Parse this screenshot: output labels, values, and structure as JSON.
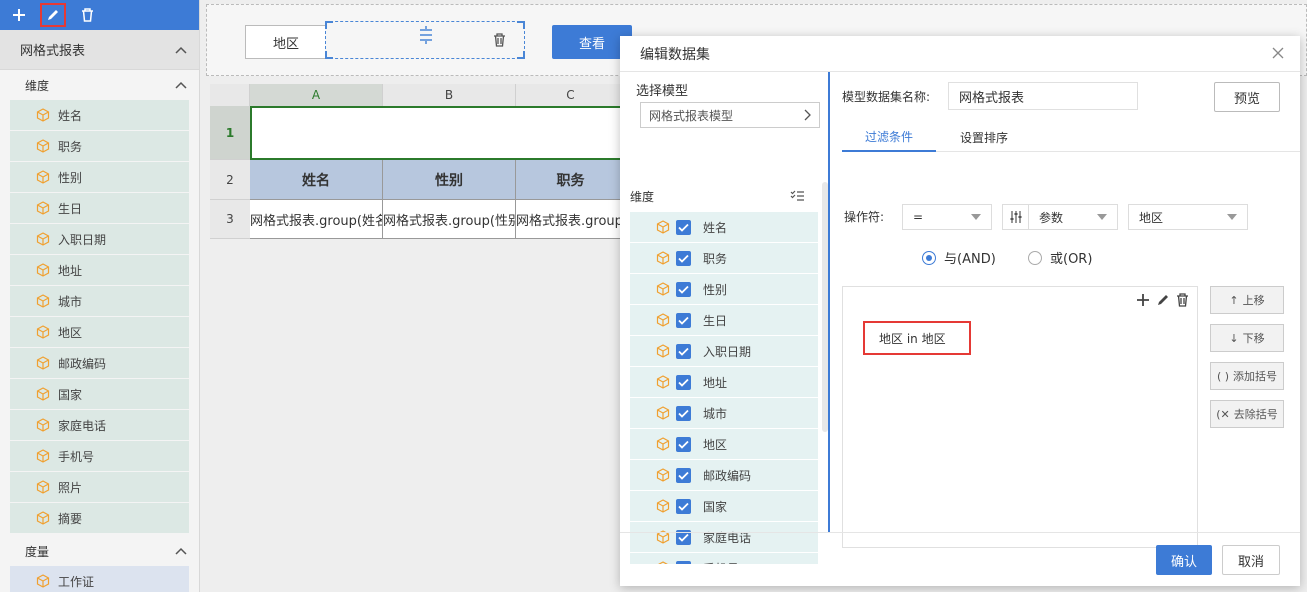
{
  "sidebar": {
    "section_title": "网格式报表",
    "dimension_title": "维度",
    "dimensions": [
      "姓名",
      "职务",
      "性别",
      "生日",
      "入职日期",
      "地址",
      "城市",
      "地区",
      "邮政编码",
      "国家",
      "家庭电话",
      "手机号",
      "照片",
      "摘要"
    ],
    "measure_title": "度量",
    "measures": [
      "工作证"
    ]
  },
  "param_panel": {
    "label": "地区",
    "view_button": "查看"
  },
  "grid": {
    "columns": [
      "A",
      "B",
      "C"
    ],
    "rows": [
      "1",
      "2",
      "3"
    ],
    "header_cells": [
      "姓名",
      "性别",
      "职务"
    ],
    "body_cells": [
      "网格式报表.group(姓名)",
      "网格式报表.group(性别)",
      "网格式报表.group(职务)"
    ]
  },
  "dialog": {
    "title": "编辑数据集",
    "select_model_label": "选择模型",
    "model_value": "网格式报表模型",
    "dimension_label": "维度",
    "dimension_items": [
      "姓名",
      "职务",
      "性别",
      "生日",
      "入职日期",
      "地址",
      "城市",
      "地区",
      "邮政编码",
      "国家",
      "家庭电话",
      "手机号"
    ],
    "dataset_name_label": "模型数据集名称:",
    "dataset_name_value": "网格式报表",
    "preview_button": "预览",
    "tabs": [
      "过滤条件",
      "设置排序"
    ],
    "operator_label": "操作符:",
    "operator_value": "=",
    "param_type_value": "参数",
    "param_value": "地区",
    "radio_and": "与(AND)",
    "radio_or": "或(OR)",
    "condition": "地区 in 地区",
    "move_up": "上移",
    "move_down": "下移",
    "add_bracket": "添加括号",
    "remove_bracket": "去除括号",
    "ok_button": "确认",
    "cancel_button": "取消"
  },
  "colors": {
    "accent": "#3d7bd6",
    "highlight": "#e53935",
    "selection": "#2b7a2b"
  }
}
